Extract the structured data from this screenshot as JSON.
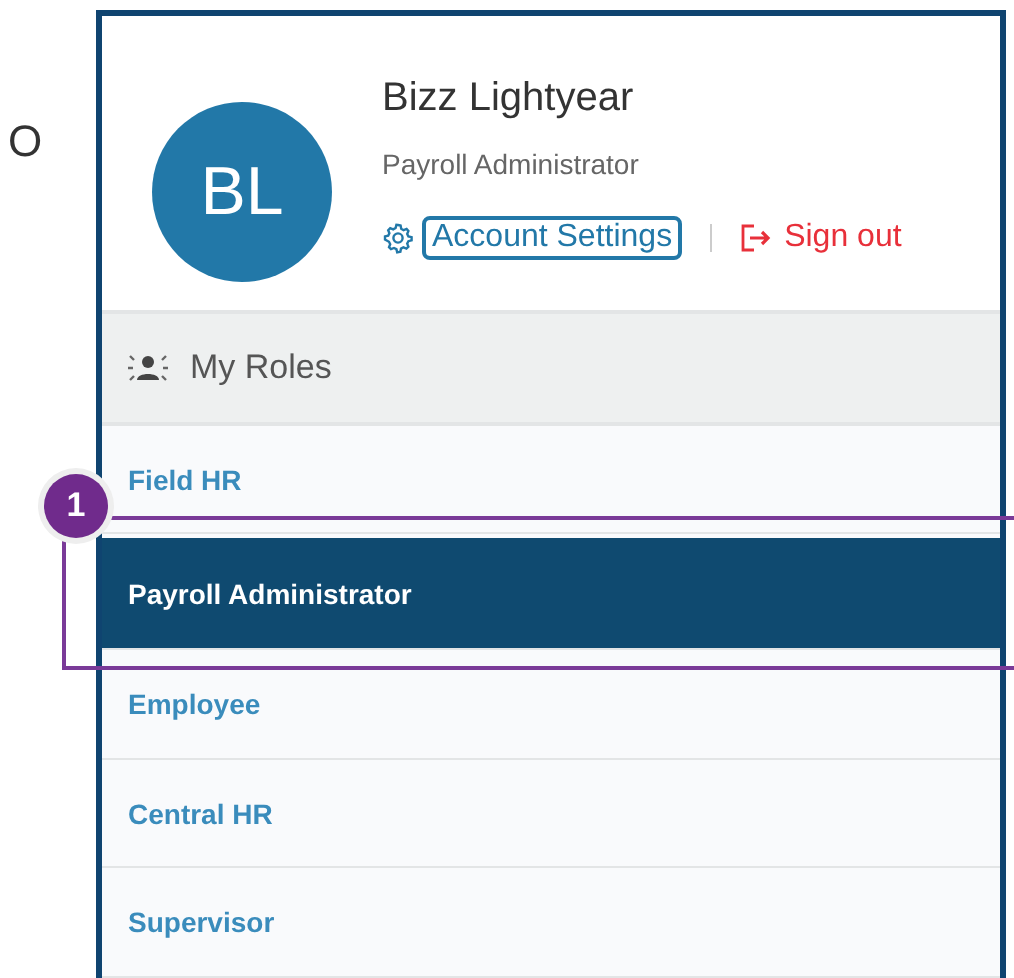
{
  "background_text": "O",
  "user": {
    "initials": "BL",
    "name": "Bizz Lightyear",
    "role": "Payroll Administrator"
  },
  "links": {
    "account_settings": "Account Settings",
    "sign_out": "Sign out"
  },
  "roles_header": "My Roles",
  "roles": [
    {
      "label": "Field HR",
      "selected": false
    },
    {
      "label": "Payroll Administrator",
      "selected": true
    },
    {
      "label": "Employee",
      "selected": false
    },
    {
      "label": "Central HR",
      "selected": false
    },
    {
      "label": "Supervisor",
      "selected": false
    }
  ],
  "annotation": {
    "number": "1"
  }
}
